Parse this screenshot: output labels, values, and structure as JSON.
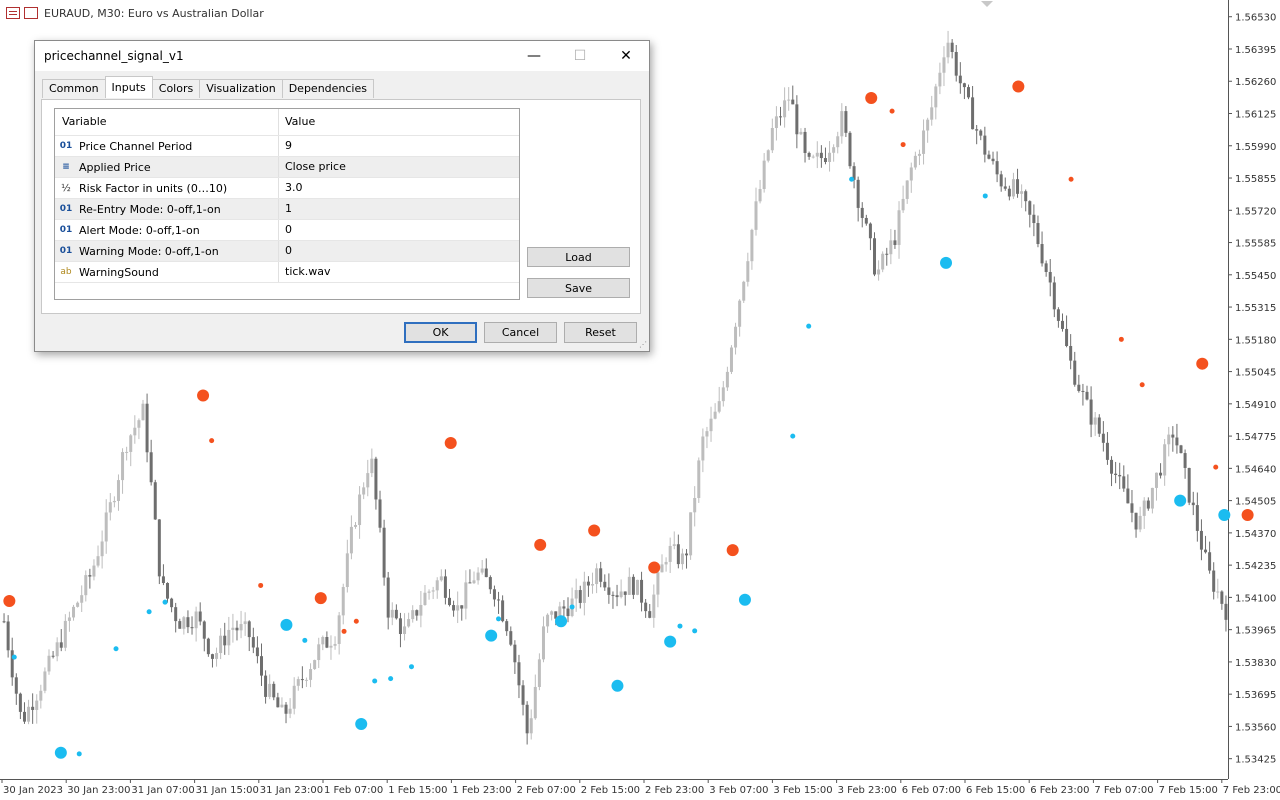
{
  "window": {
    "title": "EURAUD, M30:  Euro vs Australian Dollar"
  },
  "dialog": {
    "title": "pricechannel_signal_v1",
    "controls": {
      "minimize": "—",
      "maximize": "☐",
      "close": "✕"
    },
    "tabs": [
      {
        "label": "Common"
      },
      {
        "label": "Inputs",
        "active": true
      },
      {
        "label": "Colors"
      },
      {
        "label": "Visualization"
      },
      {
        "label": "Dependencies"
      }
    ],
    "table": {
      "headers": {
        "variable": "Variable",
        "value": "Value"
      },
      "rows": [
        {
          "icon": "01",
          "variable": "Price Channel Period",
          "value": "9"
        },
        {
          "icon": "≡",
          "variable": "Applied Price",
          "value": "Close price"
        },
        {
          "icon": "½",
          "variable": "Risk Factor in units (0…10)",
          "value": "3.0"
        },
        {
          "icon": "01",
          "variable": "Re-Entry Mode: 0-off,1-on",
          "value": "1"
        },
        {
          "icon": "01",
          "variable": "Alert Mode: 0-off,1-on",
          "value": "0"
        },
        {
          "icon": "01",
          "variable": "Warning Mode: 0-off,1-on",
          "value": "0"
        },
        {
          "icon": "ab",
          "variable": "WarningSound",
          "value": "tick.wav"
        }
      ]
    },
    "buttons": {
      "load": "Load",
      "save": "Save",
      "ok": "OK",
      "cancel": "Cancel",
      "reset": "Reset"
    }
  },
  "chart_data": {
    "type": "candlestick",
    "symbol": "EURAUD",
    "timeframe": "M30",
    "ylim": [
      1.5334,
      1.566
    ],
    "y_ticks": [
      "1.56530",
      "1.56395",
      "1.56260",
      "1.56125",
      "1.55990",
      "1.55855",
      "1.55720",
      "1.55585",
      "1.55450",
      "1.55315",
      "1.55180",
      "1.55045",
      "1.54910",
      "1.54775",
      "1.54640",
      "1.54505",
      "1.54370",
      "1.54235",
      "1.54100",
      "1.53965",
      "1.53830",
      "1.53695",
      "1.53560",
      "1.53425"
    ],
    "x_ticks": [
      "30 Jan 2023",
      "30 Jan 23:00",
      "31 Jan 07:00",
      "31 Jan 15:00",
      "31 Jan 23:00",
      "1 Feb 07:00",
      "1 Feb 15:00",
      "1 Feb 23:00",
      "2 Feb 07:00",
      "2 Feb 15:00",
      "2 Feb 23:00",
      "3 Feb 07:00",
      "3 Feb 15:00",
      "3 Feb 23:00",
      "6 Feb 07:00",
      "6 Feb 15:00",
      "6 Feb 23:00",
      "7 Feb 07:00",
      "7 Feb 15:00",
      "7 Feb 23:00"
    ],
    "price_path": [
      1.54,
      1.5358,
      1.5372,
      1.5388,
      1.5405,
      1.542,
      1.5445,
      1.5475,
      1.5488,
      1.5415,
      1.54,
      1.5402,
      1.5385,
      1.5398,
      1.5395,
      1.5372,
      1.536,
      1.5375,
      1.5388,
      1.5395,
      1.544,
      1.547,
      1.5405,
      1.5395,
      1.541,
      1.5418,
      1.5405,
      1.542,
      1.5415,
      1.5395,
      1.5352,
      1.54,
      1.5405,
      1.541,
      1.5422,
      1.5412,
      1.5416,
      1.5405,
      1.543,
      1.5425,
      1.5475,
      1.549,
      1.553,
      1.557,
      1.5605,
      1.562,
      1.559,
      1.5595,
      1.561,
      1.5575,
      1.5545,
      1.556,
      1.559,
      1.561,
      1.5645,
      1.562,
      1.56,
      1.5585,
      1.558,
      1.5565,
      1.554,
      1.551,
      1.549,
      1.5475,
      1.5455,
      1.544,
      1.546,
      1.548,
      1.545,
      1.542,
      1.5405
    ],
    "signals": {
      "sell_large": [
        [
          0.6,
          1.54085
        ],
        [
          16.4,
          1.54945
        ],
        [
          36.6,
          1.54746
        ],
        [
          26.0,
          1.54097
        ],
        [
          43.9,
          1.5432
        ],
        [
          48.3,
          1.5438
        ],
        [
          53.2,
          1.54225
        ],
        [
          59.6,
          1.54298
        ],
        [
          70.9,
          1.5619
        ],
        [
          82.9,
          1.56238
        ],
        [
          97.9,
          1.55078
        ],
        [
          101.6,
          1.54445
        ]
      ],
      "sell_small": [
        [
          17.1,
          1.54756
        ],
        [
          21.1,
          1.5415
        ],
        [
          27.9,
          1.53958
        ],
        [
          28.9,
          1.54
        ],
        [
          72.6,
          1.56135
        ],
        [
          73.5,
          1.55995
        ],
        [
          87.2,
          1.5585
        ],
        [
          91.3,
          1.5518
        ],
        [
          93.0,
          1.5499
        ],
        [
          99.0,
          1.54645
        ]
      ],
      "buy_large": [
        [
          4.8,
          1.5345
        ],
        [
          23.2,
          1.53985
        ],
        [
          29.3,
          1.5357
        ],
        [
          39.9,
          1.5394
        ],
        [
          45.6,
          1.54
        ],
        [
          50.2,
          1.5373
        ],
        [
          54.5,
          1.53915
        ],
        [
          60.6,
          1.5409
        ],
        [
          77.0,
          1.555
        ],
        [
          96.1,
          1.54505
        ],
        [
          99.7,
          1.54445
        ]
      ],
      "buy_small": [
        [
          1.0,
          1.5385
        ],
        [
          6.3,
          1.53445
        ],
        [
          9.3,
          1.53885
        ],
        [
          12.0,
          1.5404
        ],
        [
          13.3,
          1.5408
        ],
        [
          24.7,
          1.5392
        ],
        [
          30.4,
          1.5375
        ],
        [
          31.7,
          1.5376
        ],
        [
          33.4,
          1.5381
        ],
        [
          40.5,
          1.5401
        ],
        [
          46.5,
          1.5406
        ],
        [
          55.3,
          1.5398
        ],
        [
          56.5,
          1.5396
        ],
        [
          64.5,
          1.54775
        ],
        [
          65.8,
          1.55235
        ],
        [
          69.3,
          1.5585
        ],
        [
          80.2,
          1.5578
        ]
      ]
    },
    "colors": {
      "bull": "#bdbdbd",
      "bear": "#6e6e6e",
      "sell": "#f4511e",
      "buy": "#1bbcf0",
      "axis": "#555555"
    }
  }
}
